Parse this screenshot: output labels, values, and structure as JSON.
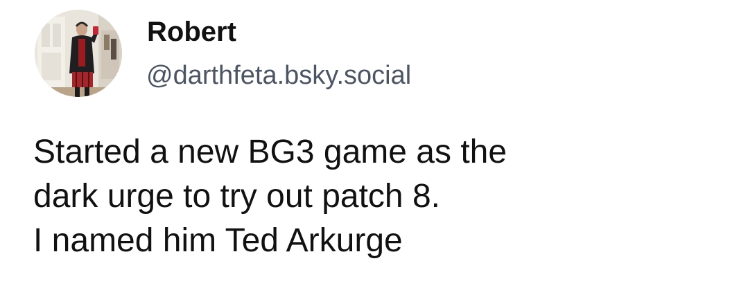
{
  "post": {
    "author": {
      "display_name": "Robert",
      "handle": "@darthfeta.bsky.social"
    },
    "text_lines": [
      "Started a new BG3 game as the",
      "dark urge to try out patch 8.",
      "I named him Ted Arkurge"
    ]
  },
  "colors": {
    "background": "#ffffff",
    "text": "#111111",
    "handle": "#4b5563"
  },
  "icons": {
    "avatar": "user-photo"
  }
}
